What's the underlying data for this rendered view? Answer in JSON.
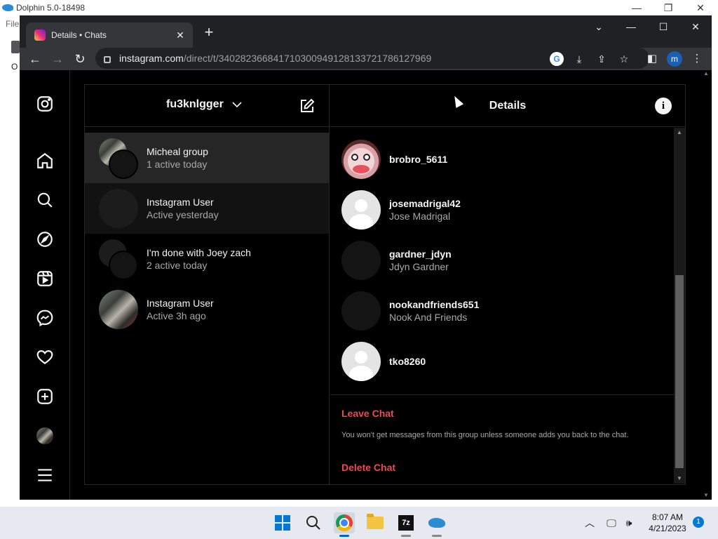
{
  "dolphin": {
    "title": "Dolphin 5.0-18498",
    "menu_first": "File",
    "left_char": "O",
    "controls": {
      "minimize": "—",
      "maximize": "❐",
      "close": "✕"
    }
  },
  "browser": {
    "tab_title": "Details • Chats",
    "tab_close": "✕",
    "new_tab": "+",
    "window_controls": {
      "dropdown": "⌄",
      "minimize": "—",
      "maximize": "☐",
      "close": "✕"
    },
    "url_host": "instagram.com",
    "url_path": "/direct/t/340282366841710300949128133721786127969",
    "profile_initial": "m"
  },
  "inbox": {
    "username": "fu3knlgger",
    "threads": [
      {
        "name": "Micheal group",
        "status": "1 active today"
      },
      {
        "name": "Instagram User",
        "status": "Active yesterday"
      },
      {
        "name": "I'm done with Joey zach",
        "status": "2 active today"
      },
      {
        "name": "Instagram User",
        "status": "Active 3h ago"
      }
    ]
  },
  "details": {
    "title": "Details",
    "info_glyph": "i",
    "members": [
      {
        "username": "brobro_5611",
        "fullname": ""
      },
      {
        "username": "josemadrigal42",
        "fullname": "Jose Madrigal"
      },
      {
        "username": "gardner_jdyn",
        "fullname": "Jdyn Gardner"
      },
      {
        "username": "nookandfriends651",
        "fullname": "Nook And Friends"
      },
      {
        "username": "tko8260",
        "fullname": ""
      }
    ],
    "leave_label": "Leave Chat",
    "leave_note": "You won't get messages from this group unless someone adds you back to the chat.",
    "delete_label": "Delete Chat"
  },
  "taskbar": {
    "time": "8:07 AM",
    "date": "4/21/2023",
    "notification_count": "1",
    "sevenzip_label": "7z"
  },
  "colors": {
    "accent_red": "#ed4956",
    "background": "#000000",
    "divider": "#262626"
  }
}
